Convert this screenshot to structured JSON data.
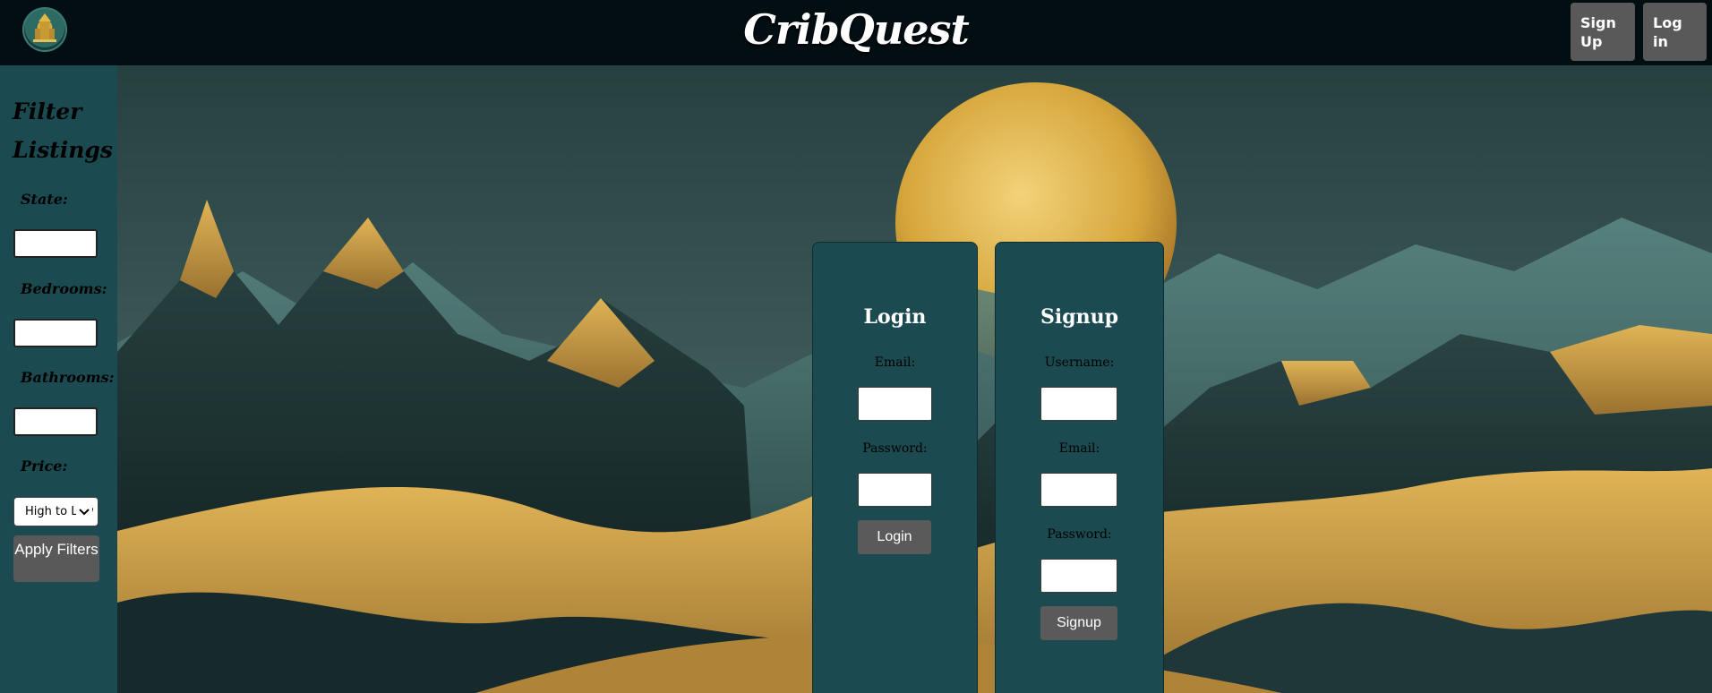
{
  "header": {
    "brand": "CribQuest",
    "signup_label": "Sign Up",
    "login_label": "Log in"
  },
  "sidebar": {
    "title": "Filter Listings",
    "state_label": "State:",
    "bedrooms_label": "Bedrooms:",
    "bathrooms_label": "Bathrooms:",
    "price_label": "Price:",
    "price_selected": "High to Low",
    "apply_label": "Apply Filters"
  },
  "login": {
    "title": "Login",
    "email_label": "Email:",
    "password_label": "Password:",
    "button_label": "Login"
  },
  "signup": {
    "title": "Signup",
    "username_label": "Username:",
    "email_label": "Email:",
    "password_label": "Password:",
    "button_label": "Signup"
  },
  "colors": {
    "topbar": "#020e12",
    "sidebar": "#1b4a50",
    "panel": "#1c4a51",
    "button": "#595959",
    "gold": "#c9a14a"
  }
}
